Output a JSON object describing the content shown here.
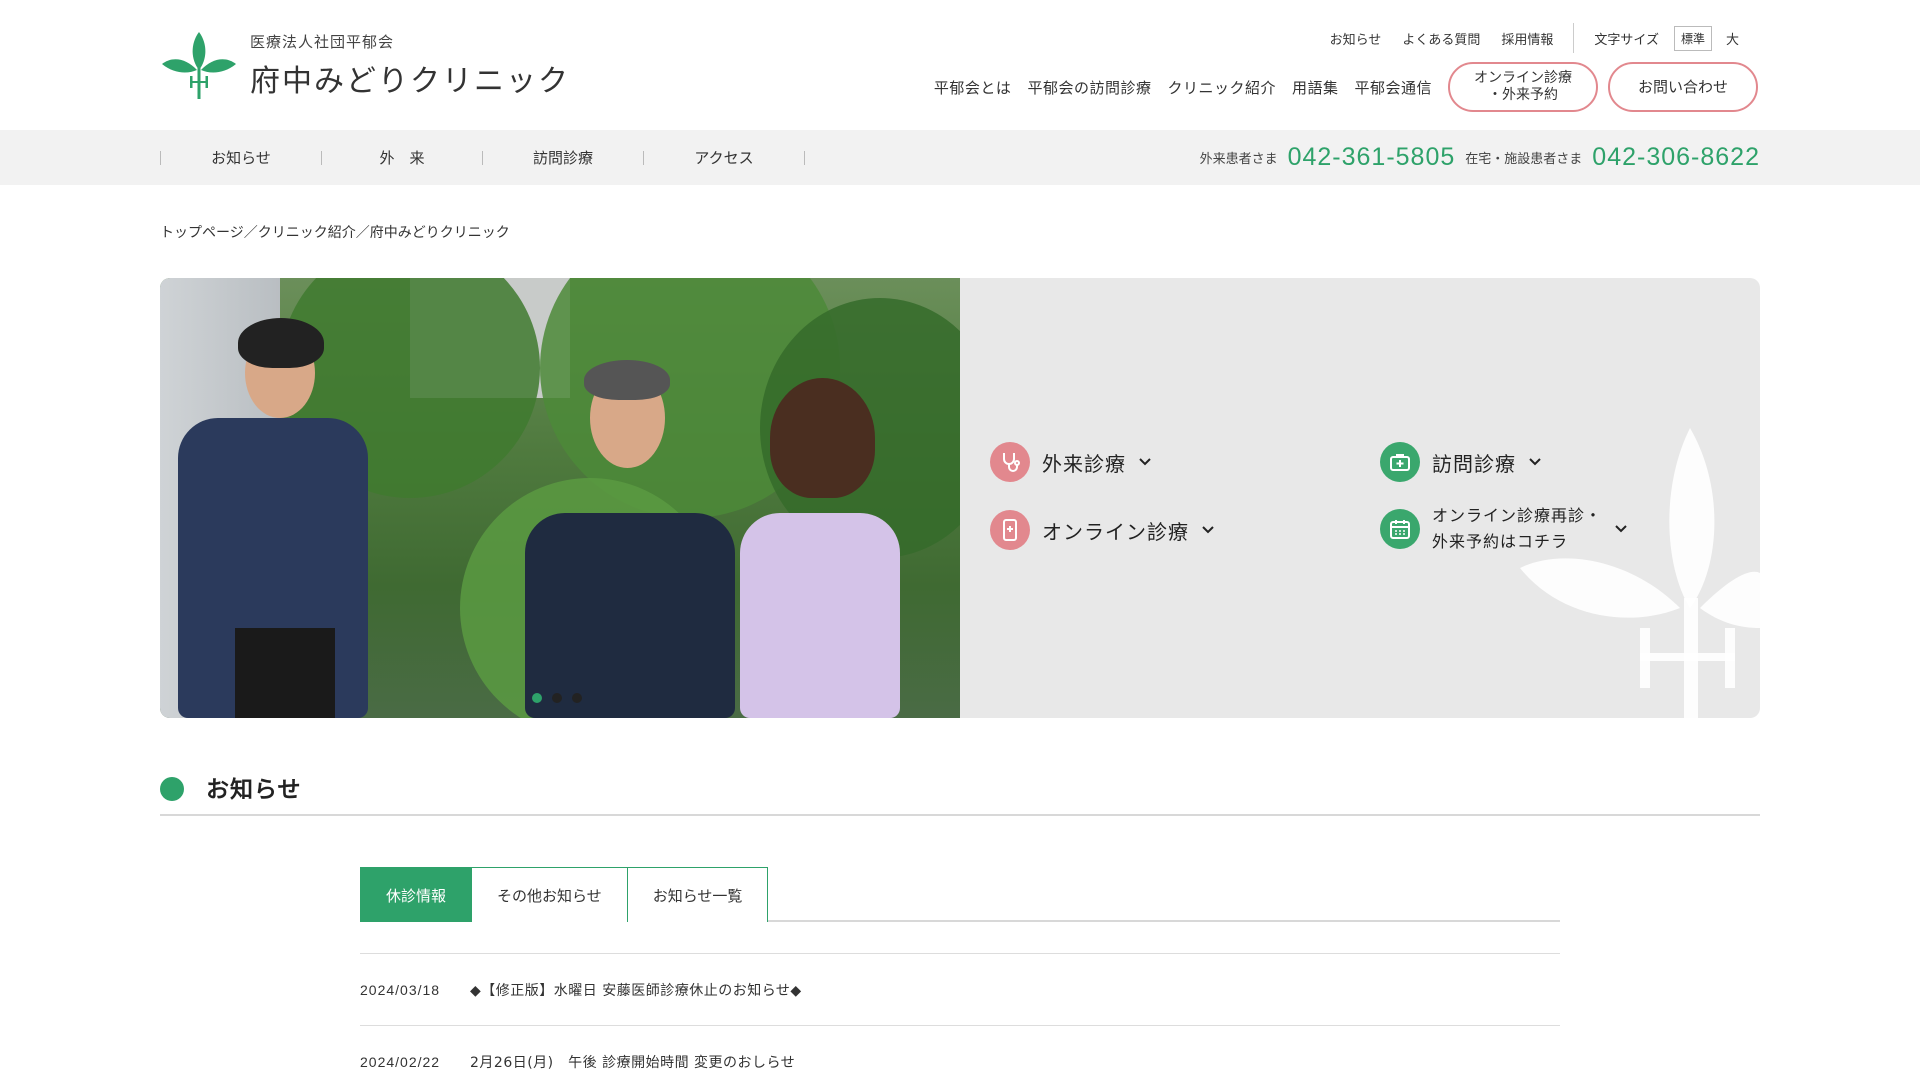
{
  "header": {
    "logo_sub": "医療法人社団平郁会",
    "logo_main": "府中みどりクリニック",
    "util_links": [
      "お知らせ",
      "よくある質問",
      "採用情報"
    ],
    "font_size_label": "文字サイズ",
    "font_size_standard": "標準",
    "font_size_large": "大",
    "nav": [
      "平郁会とは",
      "平郁会の訪問診療",
      "クリニック紹介",
      "用語集",
      "平郁会通信"
    ],
    "online_line1": "オンライン診療",
    "online_line2": "・外来予約",
    "contact": "お問い合わせ"
  },
  "subnav": {
    "items": [
      "お知らせ",
      "外　来",
      "訪問診療",
      "アクセス"
    ],
    "outpatient_label": "外来患者さま",
    "outpatient_phone": "042-361-5805",
    "home_label": "在宅・施設患者さま",
    "home_phone": "042-306-8622"
  },
  "breadcrumb": {
    "home": "トップページ",
    "sep1": "／",
    "clinic": "クリニック紹介",
    "sep2": "／",
    "current": "府中みどりクリニック"
  },
  "hero": {
    "menu": {
      "outpatient": "外来診療",
      "home_visit": "訪問診療",
      "online": "オンライン診療",
      "reserve_line1": "オンライン診療再診・",
      "reserve_line2": "外来予約はコチラ"
    },
    "slides_active": 1,
    "icons": {
      "outpatient": "stethoscope-icon",
      "home_visit": "medical-bag-icon",
      "online": "smartphone-icon",
      "reserve": "calendar-icon"
    }
  },
  "news": {
    "title": "お知らせ",
    "tabs": [
      "休診情報",
      "その他お知らせ",
      "お知らせ一覧"
    ],
    "items": [
      {
        "date": "2024/03/18",
        "text": "◆【修正版】水曜日 安藤医師診療休止のお知らせ◆"
      },
      {
        "date": "2024/02/22",
        "text": "2月26日(月)　午後 診療開始時間 変更のおしらせ"
      }
    ]
  },
  "colors": {
    "green": "#2ea26a",
    "pink": "#e2888e",
    "hero_bg": "#e8e8e8"
  }
}
